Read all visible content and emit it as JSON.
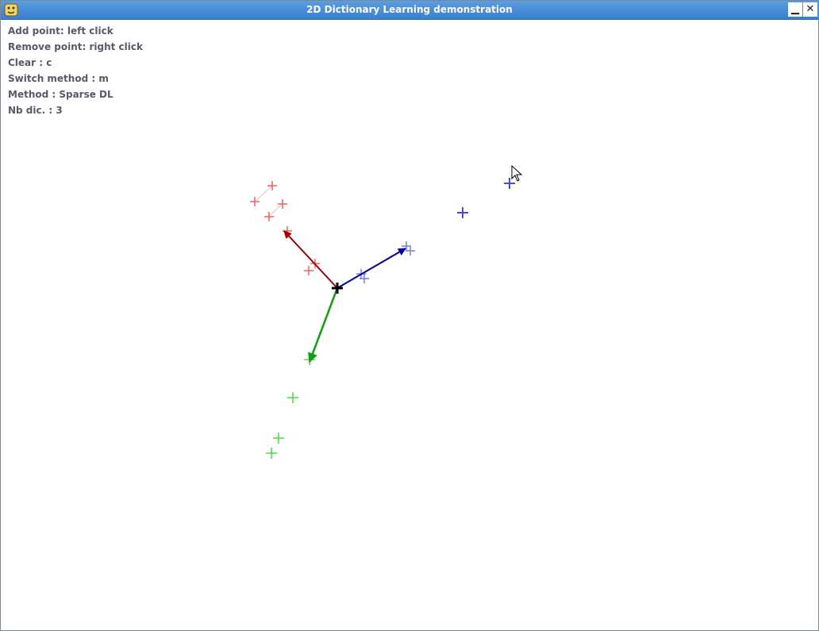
{
  "window": {
    "title": "2D Dictionary Learning demonstration",
    "minimize_label": "▁",
    "close_label": "✕"
  },
  "instructions": {
    "add_point": "Add point: left click",
    "remove_point": "Remove point: right click",
    "clear": "Clear : c",
    "switch_method": "Switch method : m",
    "method": "Method : Sparse DL",
    "nb_dic": "Nb dic. : 3"
  },
  "colors": {
    "red_points": "#f06060",
    "blue_points": "#4a4ae8",
    "green_points": "#40e040",
    "red_atom": "#a00000",
    "blue_atom": "#0000a0",
    "green_atom": "#10a010",
    "center": "#000000"
  },
  "icons": {
    "app": "python-snake-icon",
    "cursor": "mouse-pointer-icon"
  }
}
